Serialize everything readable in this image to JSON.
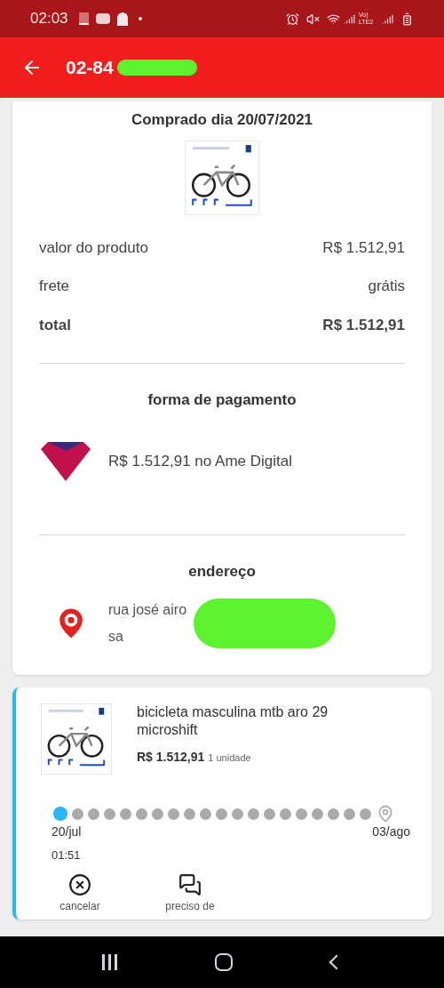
{
  "status_bar": {
    "time": "02:03",
    "network_label": "Vo) LTE2"
  },
  "app_bar": {
    "title": "02-84"
  },
  "order_card": {
    "purchase_date": "Comprado dia 20/07/2021",
    "summary": [
      {
        "label": "valor do produto",
        "value": "R$ 1.512,91",
        "kind": "normal"
      },
      {
        "label": "frete",
        "value": "grátis",
        "kind": "normal"
      },
      {
        "label": "total",
        "value": "R$ 1.512,91",
        "kind": "total"
      }
    ],
    "payment": {
      "heading": "forma de pagamento",
      "text": "R$ 1.512,91 no Ame Digital"
    },
    "address": {
      "heading": "endereço",
      "lines": [
        "rua josé airo",
        "sa"
      ]
    }
  },
  "item_card": {
    "name": "bicicleta masculina mtb aro 29 microshift",
    "price": "R$ 1.512,91",
    "quantity": "1 unidade",
    "steps": [
      {
        "reached": true
      },
      {
        "reached": false
      },
      {
        "reached": false
      },
      {
        "reached": false
      },
      {
        "reached": false
      },
      {
        "reached": false
      },
      {
        "reached": false
      },
      {
        "reached": false
      },
      {
        "reached": false
      },
      {
        "reached": false
      },
      {
        "reached": false
      },
      {
        "reached": false
      },
      {
        "reached": false
      },
      {
        "reached": false
      },
      {
        "reached": false
      },
      {
        "reached": false
      },
      {
        "reached": false
      },
      {
        "reached": false
      },
      {
        "reached": false
      },
      {
        "reached": false
      }
    ],
    "start_date": "20/jul",
    "start_time": "01:51",
    "end_date": "03/ago",
    "actions": [
      {
        "kind": "cancel",
        "label": "cancelar"
      },
      {
        "kind": "help",
        "label": "preciso de"
      }
    ]
  }
}
